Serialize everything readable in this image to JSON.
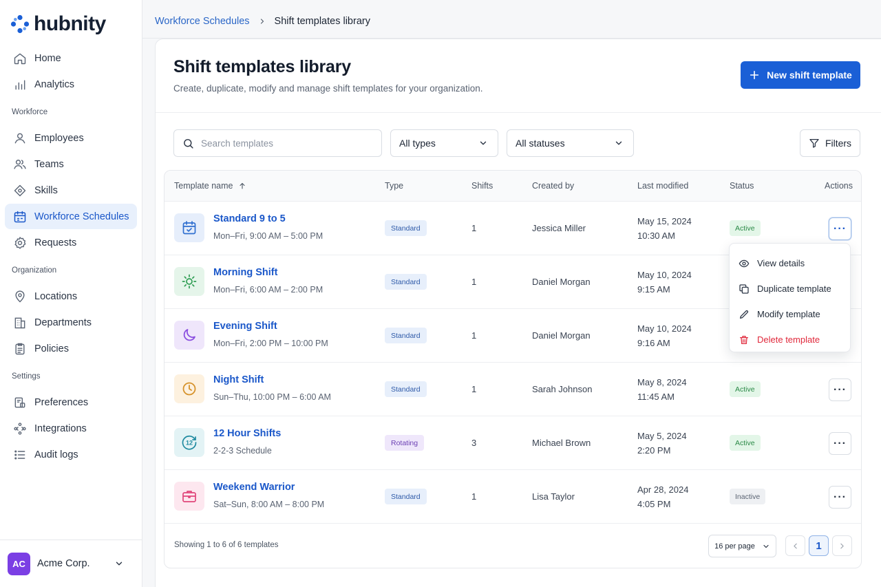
{
  "app": {
    "logo_text": "hubnity"
  },
  "sidebar": {
    "top_items": [
      {
        "label": "Home",
        "icon": "home-icon"
      },
      {
        "label": "Analytics",
        "icon": "bar-chart-icon"
      }
    ],
    "sections": [
      {
        "title": "Workforce",
        "items": [
          {
            "label": "Employees",
            "icon": "user-icon"
          },
          {
            "label": "Teams",
            "icon": "users-icon"
          },
          {
            "label": "Skills",
            "icon": "diamond-icon"
          },
          {
            "label": "Workforce Schedules",
            "icon": "calendar-icon",
            "active": true
          },
          {
            "label": "Requests",
            "icon": "gear-badge-icon"
          }
        ]
      },
      {
        "title": "Organization",
        "items": [
          {
            "label": "Locations",
            "icon": "map-pin-icon"
          },
          {
            "label": "Departments",
            "icon": "building-icon"
          },
          {
            "label": "Policies",
            "icon": "clipboard-icon"
          }
        ]
      },
      {
        "title": "Settings",
        "items": [
          {
            "label": "Preferences",
            "icon": "sliders-icon"
          },
          {
            "label": "Integrations",
            "icon": "integrations-icon"
          },
          {
            "label": "Audit logs",
            "icon": "list-icon"
          }
        ]
      }
    ],
    "org": {
      "initials": "AC",
      "name": "Acme Corp."
    }
  },
  "breadcrumb": {
    "parent": "Workforce Schedules",
    "separator": ">",
    "current": "Shift templates library"
  },
  "page": {
    "title": "Shift templates library",
    "subtitle": "Create, duplicate, modify and manage shift templates for your organization.",
    "new_button": "New shift template"
  },
  "filters": {
    "search_placeholder": "Search templates",
    "type_value": "All types",
    "status_value": "All statuses",
    "filters_label": "Filters"
  },
  "table": {
    "headers": {
      "name": "Template name",
      "type": "Type",
      "shifts": "Shifts",
      "created_by": "Created by",
      "last_modified": "Last modified",
      "status": "Status",
      "actions": "Actions"
    },
    "rows": [
      {
        "name": "Standard 9 to 5",
        "schedule": "Mon–Fri, 9:00 AM – 5:00 PM",
        "type": "Standard",
        "shifts": "1",
        "created_by": "Jessica Miller",
        "date": "May 15, 2024",
        "time": "10:30 AM",
        "status": "Active",
        "icon": "calendar-check-icon",
        "icon_color": "#2f6fd0",
        "icon_bg": "#e6eefb"
      },
      {
        "name": "Morning Shift",
        "schedule": "Mon–Fri, 6:00 AM – 2:00 PM",
        "type": "Standard",
        "shifts": "1",
        "created_by": "Daniel Morgan",
        "date": "May 10, 2024",
        "time": "9:15 AM",
        "status": "",
        "icon": "sun-icon",
        "icon_color": "#2e9d52",
        "icon_bg": "#e5f5ea"
      },
      {
        "name": "Evening Shift",
        "schedule": "Mon–Fri, 2:00 PM – 10:00 PM",
        "type": "Standard",
        "shifts": "1",
        "created_by": "Daniel Morgan",
        "date": "May 10, 2024",
        "time": "9:16 AM",
        "status": "",
        "icon": "moon-icon",
        "icon_color": "#8a4fe0",
        "icon_bg": "#efe6fb"
      },
      {
        "name": "Night Shift",
        "schedule": "Sun–Thu, 10:00 PM – 6:00 AM",
        "type": "Standard",
        "shifts": "1",
        "created_by": "Sarah Johnson",
        "date": "May 8, 2024",
        "time": "11:45 AM",
        "status": "Active",
        "icon": "clock-icon",
        "icon_color": "#d6922a",
        "icon_bg": "#fdf1df"
      },
      {
        "name": "12 Hour Shifts",
        "schedule": "2-2-3 Schedule",
        "type": "Rotating",
        "shifts": "3",
        "created_by": "Michael Brown",
        "date": "May 5, 2024",
        "time": "2:20 PM",
        "status": "Active",
        "icon": "clock-12-icon",
        "icon_color": "#1f8aa0",
        "icon_bg": "#e3f3f5"
      },
      {
        "name": "Weekend Warrior",
        "schedule": "Sat–Sun, 8:00 AM – 8:00 PM",
        "type": "Standard",
        "shifts": "1",
        "created_by": "Lisa Taylor",
        "date": "Apr 28, 2024",
        "time": "4:05 PM",
        "status": "Inactive",
        "icon": "briefcase-icon",
        "icon_color": "#e0457a",
        "icon_bg": "#fde7ef"
      }
    ],
    "row_menu": {
      "view": "View details",
      "duplicate": "Duplicate template",
      "modify": "Modify template",
      "delete": "Delete template"
    },
    "footer": {
      "showing": "Showing 1 to 6 of 6 templates",
      "per_page": "16 per page",
      "current_page": "1"
    }
  },
  "colors": {
    "brand": "#1a5fd6",
    "active_nav_bg": "#e8f0fc",
    "danger": "#e0283b"
  }
}
